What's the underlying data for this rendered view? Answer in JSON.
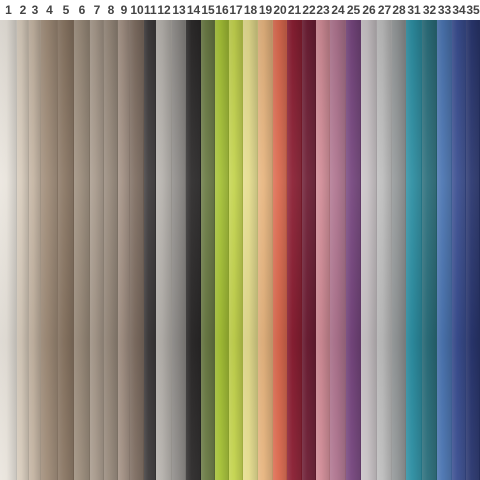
{
  "swatches": [
    {
      "number": "1",
      "color": "#e9e4dc"
    },
    {
      "number": "2",
      "color": "#d7cbbb"
    },
    {
      "number": "3",
      "color": "#c4b4a2"
    },
    {
      "number": "4",
      "color": "#a08c78"
    },
    {
      "number": "5",
      "color": "#8b7764"
    },
    {
      "number": "6",
      "color": "#9c8d7c"
    },
    {
      "number": "7",
      "color": "#a89a8c"
    },
    {
      "number": "8",
      "color": "#988a7c"
    },
    {
      "number": "9",
      "color": "#a39184"
    },
    {
      "number": "10",
      "color": "#7f6e62"
    },
    {
      "number": "11",
      "color": "#3f3c3d"
    },
    {
      "number": "12",
      "color": "#b6b2ad"
    },
    {
      "number": "13",
      "color": "#8e8b88"
    },
    {
      "number": "14",
      "color": "#2d2b2b"
    },
    {
      "number": "15",
      "color": "#6b7b45"
    },
    {
      "number": "16",
      "color": "#a6c236"
    },
    {
      "number": "17",
      "color": "#c4d44e"
    },
    {
      "number": "18",
      "color": "#e6dd8e"
    },
    {
      "number": "19",
      "color": "#e7b57f"
    },
    {
      "number": "20",
      "color": "#dd6a4f"
    },
    {
      "number": "21",
      "color": "#8b1f33"
    },
    {
      "number": "22",
      "color": "#6e1f35"
    },
    {
      "number": "23",
      "color": "#d18c97"
    },
    {
      "number": "24",
      "color": "#b07590"
    },
    {
      "number": "25",
      "color": "#76467e"
    },
    {
      "number": "26",
      "color": "#c9c3c6"
    },
    {
      "number": "27",
      "color": "#bdbdbd"
    },
    {
      "number": "28",
      "color": "#929697"
    },
    {
      "number": "31",
      "color": "#2d8fa3"
    },
    {
      "number": "32",
      "color": "#2b6f7c"
    },
    {
      "number": "33",
      "color": "#4b75b2"
    },
    {
      "number": "34",
      "color": "#3a4e91"
    },
    {
      "number": "35",
      "color": "#2a3770"
    }
  ]
}
